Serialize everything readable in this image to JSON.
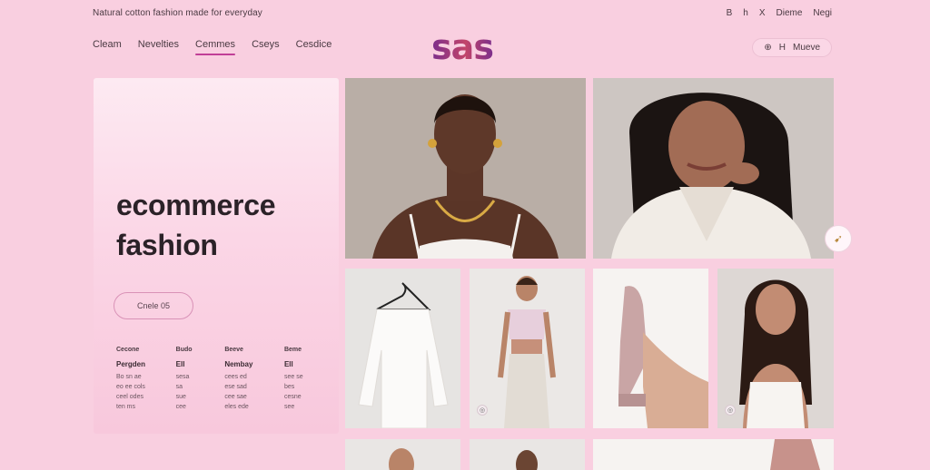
{
  "topbar": {
    "promo": "Natural cotton fashion made for everyday",
    "utils": [
      "B",
      "h",
      "X",
      "Dieme",
      "Negi"
    ]
  },
  "nav": {
    "items": [
      {
        "label": "Cleam",
        "active": false
      },
      {
        "label": "Nevelties",
        "active": false
      },
      {
        "label": "Cemmes",
        "active": true
      },
      {
        "label": "Cseys",
        "active": false
      },
      {
        "label": "Cesdice",
        "active": false
      }
    ]
  },
  "logo": "sas",
  "account": {
    "icon": "⊕",
    "short": "H",
    "label": "Mueve"
  },
  "hero": {
    "title_line1": "ecommerce",
    "title_line2": "fashion",
    "cta": "Cnele 05",
    "columns": [
      {
        "heading": "Cecone",
        "sub": "Pergden",
        "lines": [
          "Bo sn ae",
          "eo ee cols",
          "ceel odes",
          "ten ms"
        ]
      },
      {
        "heading": "Budo",
        "sub": "Ell",
        "lines": [
          "sesa",
          "sa",
          "sue",
          "cee"
        ]
      },
      {
        "heading": "Beeve",
        "sub": "Nembay",
        "lines": [
          "cees ed",
          "ese sad",
          "cee sae",
          "eles ede"
        ]
      },
      {
        "heading": "Beme",
        "sub": "Ell",
        "lines": [
          "see se",
          "bes",
          "cesne",
          "see"
        ]
      }
    ]
  },
  "colors": {
    "background": "#f9cfe0",
    "accent": "#c03f97",
    "logo_start": "#7b2e8c",
    "logo_mid": "#c2456a"
  },
  "side_button_icon": "arrow-icon"
}
